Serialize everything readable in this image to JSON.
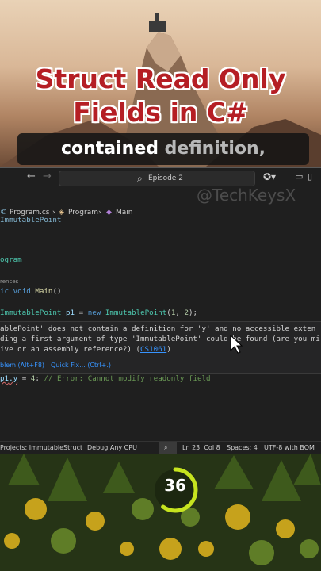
{
  "overlay": {
    "title_line1": "Struct Read Only",
    "title_line2": "Fields in C#",
    "caption_word1": "contained",
    "caption_word2": "definition,"
  },
  "ide": {
    "search_text": "Episode 2",
    "watermark": "@TechKeysX",
    "breadcrumb": {
      "file": "Program.cs",
      "class": "Program",
      "method": "Main"
    },
    "code": {
      "line_partial_top": "ImmutablePoint",
      "line_class": "ogram",
      "references": "rences",
      "line_main_kw1": "ic",
      "line_main_kw2": "void",
      "line_main_fn": "Main",
      "line_main_tail": "()",
      "decl_type": "ImmutablePoint",
      "decl_var": "p1",
      "decl_eq": " = ",
      "decl_new": "new",
      "decl_ctor": "ImmutablePoint",
      "decl_args_open": "(",
      "decl_arg1": "1",
      "decl_sep": ", ",
      "decl_arg2": "2",
      "decl_close": ");",
      "assign_var": "p1",
      "assign_member": ".y",
      "assign_rest": " = ",
      "assign_val": "4",
      "assign_semi": "; ",
      "assign_comment": "// Error: Cannot modify readonly field"
    },
    "error": {
      "line1": "ablePoint' does not contain a definition for 'y' and no accessible exten",
      "line2": "ding a first argument of type 'ImmutablePoint' could be found (are you mi",
      "line3_pre": "ive or an assembly reference?) (",
      "line3_code": "CS1061",
      "line3_post": ")",
      "action_show": "blem (Alt+F8)",
      "action_fix": "Quick Fix... (Ctrl+.)"
    },
    "status": {
      "projects": "Projects: ImmutableStruct",
      "config": "Debug Any CPU",
      "position": "Ln 23, Col 8",
      "spaces": "Spaces: 4",
      "encoding": "UTF-8 with BOM"
    }
  },
  "timer": {
    "value": "36",
    "progress": 0.6,
    "ring_color": "#c6e41f"
  },
  "colors": {
    "title_red": "#b51e24",
    "ide_bg": "#1f1f1f"
  }
}
